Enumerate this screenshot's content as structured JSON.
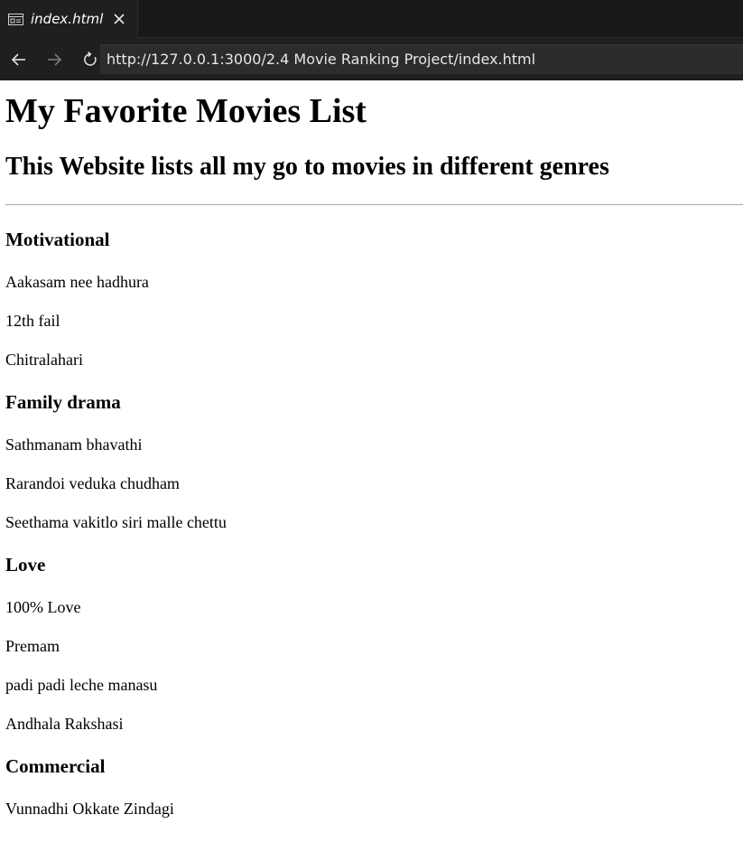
{
  "browser": {
    "tab": {
      "title": "index.html"
    },
    "address_bar": {
      "url": "http://127.0.0.1:3000/2.4 Movie Ranking Project/index.html"
    }
  },
  "page": {
    "title": "My Favorite Movies List",
    "subtitle": "This Website lists all my go to movies in different genres",
    "genres": [
      {
        "name": "Motivational",
        "movies": [
          "Aakasam nee hadhura",
          "12th fail",
          "Chitralahari"
        ]
      },
      {
        "name": "Family drama",
        "movies": [
          "Sathmanam bhavathi",
          "Rarandoi veduka chudham",
          "Seethama vakitlo siri malle chettu"
        ]
      },
      {
        "name": "Love",
        "movies": [
          "100% Love",
          "Premam",
          "padi padi leche manasu",
          "Andhala Rakshasi"
        ]
      },
      {
        "name": "Commercial",
        "movies": [
          "Vunnadhi Okkate Zindagi"
        ]
      }
    ]
  }
}
